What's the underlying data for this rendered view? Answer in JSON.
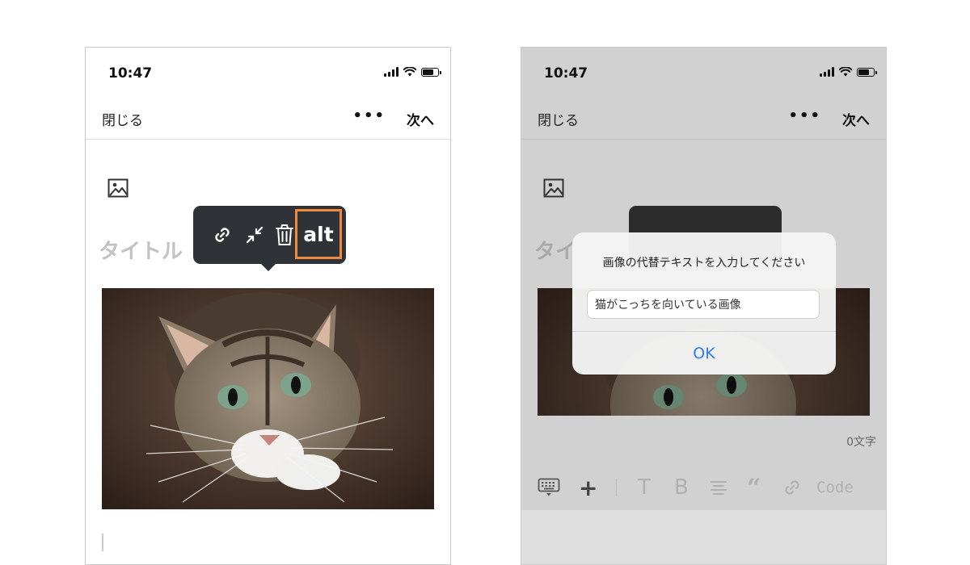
{
  "left_screen": {
    "status": {
      "time": "10:47"
    },
    "nav": {
      "close_label": "閉じる",
      "more_label": "•••",
      "next_label": "次へ"
    },
    "editor": {
      "title_placeholder": "タイトル"
    },
    "image_toolbar": {
      "alt_label": "alt",
      "icons": [
        "link-icon",
        "shrink-icon",
        "trash-icon"
      ]
    }
  },
  "right_screen": {
    "status": {
      "time": "10:47"
    },
    "nav": {
      "close_label": "閉じる",
      "more_label": "•••",
      "next_label": "次へ"
    },
    "editor": {
      "title_placeholder": "タイ"
    },
    "alert": {
      "title": "画像の代替テキストを入力してください",
      "input_value": "猫がこっちを向いている画像",
      "ok_label": "OK"
    },
    "word_count": "0文字",
    "keyboard_toolbar": {
      "text_label": "T",
      "bold_label": "B",
      "quote_label": "“",
      "code_label": "Code",
      "icons": [
        "keyboard-icon",
        "plus-icon",
        "align-icon",
        "link-icon"
      ]
    }
  },
  "colors": {
    "highlight": "#ef8b3e",
    "toolbar_bg": "#2f3337",
    "alert_button": "#2e7cf6",
    "dim_bg": "#d1d1d1"
  }
}
